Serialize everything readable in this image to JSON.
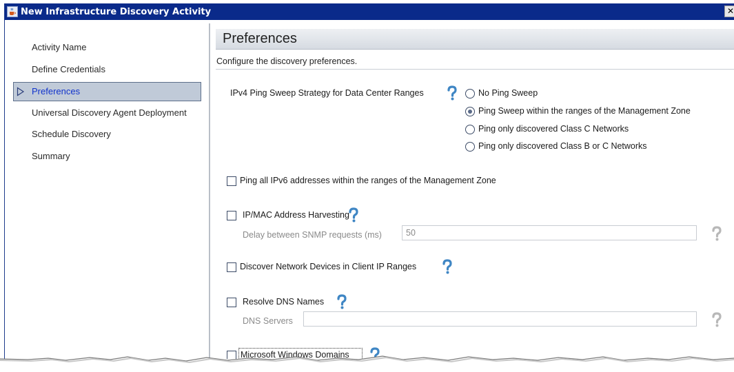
{
  "window": {
    "title": "New Infrastructure Discovery Activity",
    "close_glyph": "✕"
  },
  "nav": {
    "items": [
      {
        "label": "Activity Name"
      },
      {
        "label": "Define Credentials"
      },
      {
        "label": "Preferences",
        "selected": true
      },
      {
        "label": "Universal Discovery Agent Deployment"
      },
      {
        "label": "Schedule Discovery"
      },
      {
        "label": "Summary"
      }
    ]
  },
  "page": {
    "title": "Preferences",
    "subtitle": "Configure the discovery preferences."
  },
  "ping_sweep": {
    "label": "IPv4 Ping Sweep Strategy for Data Center Ranges",
    "options": [
      {
        "label": "No Ping Sweep",
        "checked": false
      },
      {
        "label": "Ping Sweep within the ranges of the Management Zone",
        "checked": true
      },
      {
        "label": "Ping only discovered Class C Networks",
        "checked": false
      },
      {
        "label": "Ping only discovered Class B or C Networks",
        "checked": false
      }
    ]
  },
  "ipv6": {
    "label": "Ping all IPv6 addresses within the ranges of the Management Zone",
    "checked": false
  },
  "ipmac": {
    "label": "IP/MAC Address Harvesting",
    "checked": false,
    "delay_label": "Delay between SNMP requests (ms)",
    "delay_value": "50"
  },
  "network_devices": {
    "label": "Discover Network Devices in Client IP Ranges",
    "checked": false
  },
  "dns": {
    "label": "Resolve DNS Names",
    "checked": false,
    "servers_label": "DNS Servers",
    "servers_value": ""
  },
  "windows_domains": {
    "label": "Microsoft Windows Domains",
    "checked": false
  },
  "colors": {
    "titlebar": "#0a2a8a",
    "selected_nav_bg": "#c0cad8",
    "selected_nav_text": "#1133cc",
    "help_icon": "#3f86c4",
    "help_icon_disabled": "#b8b8b8"
  },
  "icons": {
    "app": "java-cup-icon",
    "nav_selected": "triangle-right-icon",
    "help": "question-mark-icon",
    "close": "close-icon"
  }
}
